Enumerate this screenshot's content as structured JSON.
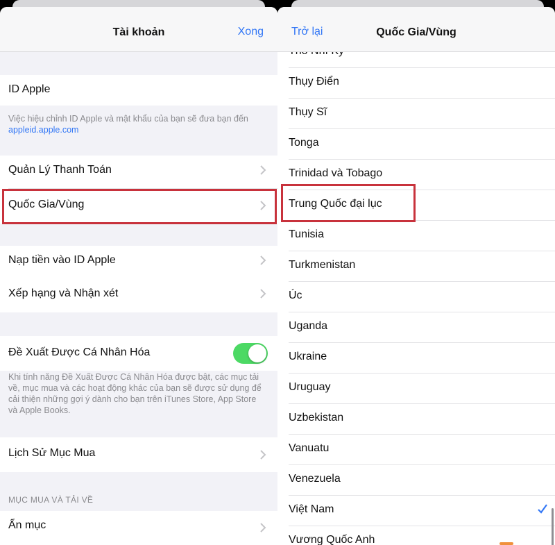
{
  "left": {
    "title": "Tài khoản",
    "done": "Xong",
    "apple_id_label": "ID Apple",
    "apple_id_note": "Việc hiệu chỉnh ID Apple và mật khẩu của bạn sẽ đưa bạn đến",
    "apple_id_link": "appleid.apple.com",
    "payment": "Quản Lý Thanh Toán",
    "country_region": "Quốc Gia/Vùng",
    "add_funds": "Nạp tiền vào ID Apple",
    "ratings": "Xếp hạng và Nhận xét",
    "personalized": "Đề Xuất Được Cá Nhân Hóa",
    "personalized_enabled": true,
    "personalized_note": "Khi tính năng Đề Xuất Được Cá Nhân Hóa được bật, các mục tải về, mục mua và các hoạt động khác của bạn sẽ được sử dụng để cải thiện những gợi ý dành cho bạn trên iTunes Store, App Store và Apple Books.",
    "purchase_history": "Lịch Sử Mục Mua",
    "downloads_header": "MỤC MUA VÀ TẢI VỀ",
    "hidden": "Ẩn mục"
  },
  "right": {
    "back": "Trở lại",
    "title": "Quốc Gia/Vùng",
    "countries": [
      {
        "name": "Thổ Nhĩ Kỳ",
        "selected": false
      },
      {
        "name": "Thụy Điển",
        "selected": false
      },
      {
        "name": "Thụy Sĩ",
        "selected": false
      },
      {
        "name": "Tonga",
        "selected": false
      },
      {
        "name": "Trinidad và Tobago",
        "selected": false
      },
      {
        "name": "Trung Quốc đại lục",
        "selected": false
      },
      {
        "name": "Tunisia",
        "selected": false
      },
      {
        "name": "Turkmenistan",
        "selected": false
      },
      {
        "name": "Úc",
        "selected": false
      },
      {
        "name": "Uganda",
        "selected": false
      },
      {
        "name": "Ukraine",
        "selected": false
      },
      {
        "name": "Uruguay",
        "selected": false
      },
      {
        "name": "Uzbekistan",
        "selected": false
      },
      {
        "name": "Vanuatu",
        "selected": false
      },
      {
        "name": "Venezuela",
        "selected": false
      },
      {
        "name": "Việt Nam",
        "selected": true
      },
      {
        "name": "Vương Quốc Anh",
        "selected": false
      }
    ]
  },
  "colors": {
    "accent": "#3478f6",
    "toggle_on": "#4cd964",
    "highlight": "#c8323c"
  }
}
